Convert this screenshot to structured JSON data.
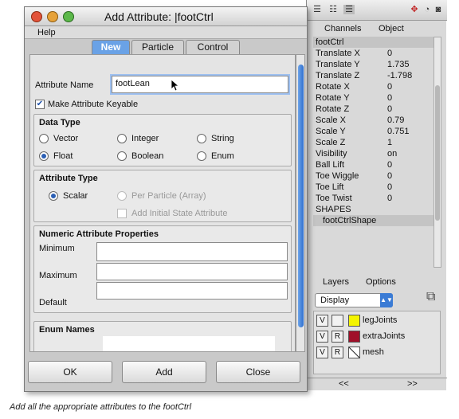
{
  "dialog": {
    "title": "Add Attribute: |footCtrl",
    "menu": {
      "help": "Help"
    },
    "tabs": [
      {
        "label": "New",
        "active": true
      },
      {
        "label": "Particle",
        "active": false
      },
      {
        "label": "Control",
        "active": false
      }
    ],
    "attribute_name": {
      "label": "Attribute Name",
      "value": "footLean"
    },
    "make_keyable": {
      "label": "Make Attribute Keyable",
      "checked": true
    },
    "data_type": {
      "title": "Data Type",
      "options": [
        "Vector",
        "Integer",
        "String",
        "Float",
        "Boolean",
        "Enum"
      ],
      "selected": "Float"
    },
    "attribute_type": {
      "title": "Attribute Type",
      "scalar": "Scalar",
      "per_particle": "Per Particle (Array)",
      "add_initial_state": "Add Initial State Attribute",
      "selected": "Scalar"
    },
    "numeric": {
      "title": "Numeric Attribute Properties",
      "minimum": "Minimum",
      "maximum": "Maximum",
      "default": "Default"
    },
    "enum": {
      "title": "Enum Names"
    },
    "buttons": {
      "ok": "OK",
      "add": "Add",
      "close": "Close"
    }
  },
  "channel_box": {
    "header": {
      "channels": "Channels",
      "object": "Object"
    },
    "node": "footCtrl",
    "attributes": [
      {
        "label": "Translate X",
        "value": "0"
      },
      {
        "label": "Translate Y",
        "value": "1.735"
      },
      {
        "label": "Translate Z",
        "value": "-1.798"
      },
      {
        "label": "Rotate X",
        "value": "0"
      },
      {
        "label": "Rotate Y",
        "value": "0"
      },
      {
        "label": "Rotate Z",
        "value": "0"
      },
      {
        "label": "Scale X",
        "value": "0.79"
      },
      {
        "label": "Scale Y",
        "value": "0.751"
      },
      {
        "label": "Scale Z",
        "value": "1"
      },
      {
        "label": "Visibility",
        "value": "on"
      },
      {
        "label": "Ball Lift",
        "value": "0"
      },
      {
        "label": "Toe Wiggle",
        "value": "0"
      },
      {
        "label": "Toe Lift",
        "value": "0"
      },
      {
        "label": "Toe Twist",
        "value": "0"
      }
    ],
    "shapes_label": "SHAPES",
    "shape": "footCtrlShape"
  },
  "layer_editor": {
    "tabs": {
      "layers": "Layers",
      "options": "Options"
    },
    "display": "Display",
    "layers": [
      {
        "v": "V",
        "r": "",
        "color": "#f4f400",
        "name": "legJoints"
      },
      {
        "v": "V",
        "r": "R",
        "color": "#a0102a",
        "name": "extraJoints"
      },
      {
        "v": "V",
        "r": "R",
        "color": "",
        "name": "mesh"
      }
    ],
    "nav": {
      "prev": "<<",
      "next": ">>"
    }
  },
  "caption": "Add all the appropriate attributes to the footCtrl"
}
